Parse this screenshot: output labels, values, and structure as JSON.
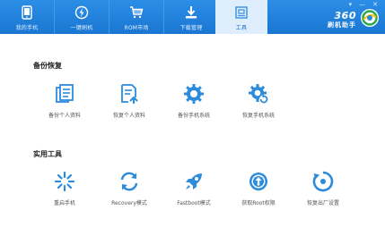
{
  "colors": {
    "header": "#1a76d2",
    "accent": "#2d8bdc",
    "active_tab_bg": "#dfeefc"
  },
  "header": {
    "tabs": [
      {
        "label": "我的手机",
        "icon": "phone-icon"
      },
      {
        "label": "一键刷机",
        "icon": "lightning-icon"
      },
      {
        "label": "ROM市场",
        "icon": "cart-icon"
      },
      {
        "label": "下载管理",
        "icon": "download-icon"
      },
      {
        "label": "工具",
        "icon": "toolbox-icon",
        "active": true
      }
    ],
    "logo": {
      "text": "360",
      "subtext": "刷机助手"
    }
  },
  "backup": {
    "title": "备份恢复",
    "items": [
      {
        "label": "备份个人资料",
        "icon": "backup-personal-icon"
      },
      {
        "label": "恢复个人资料",
        "icon": "restore-personal-icon"
      },
      {
        "label": "备份手机系统",
        "icon": "backup-system-icon"
      },
      {
        "label": "恢复手机系统",
        "icon": "restore-system-icon"
      }
    ]
  },
  "tools": {
    "title": "实用工具",
    "items": [
      {
        "label": "重启手机",
        "icon": "restart-icon"
      },
      {
        "label": "Recovery模式",
        "icon": "recovery-icon"
      },
      {
        "label": "Fastboot模式",
        "icon": "rocket-icon"
      },
      {
        "label": "获取Root权限",
        "icon": "root-icon"
      },
      {
        "label": "恢复出厂设置",
        "icon": "factory-reset-icon"
      }
    ]
  }
}
